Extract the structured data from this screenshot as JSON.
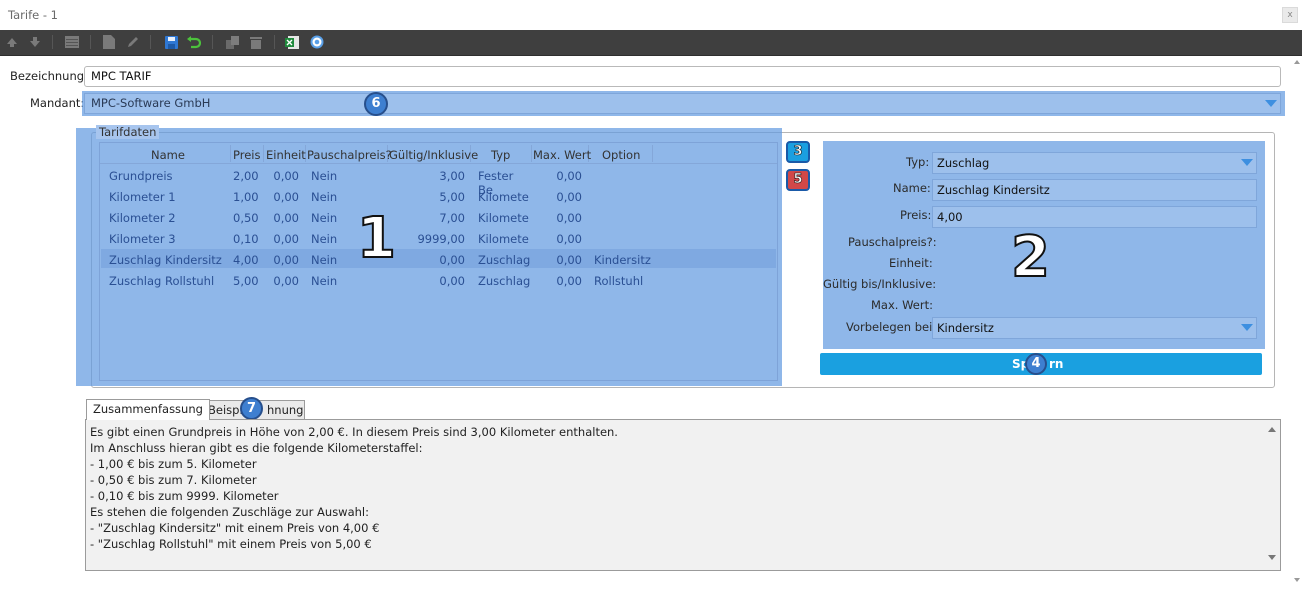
{
  "window": {
    "title": "Tarife - 1",
    "close_glyph": "x"
  },
  "toolbar": {
    "icons": [
      "arrow-up-icon",
      "arrow-down-icon",
      "grid-icon",
      "new-document-icon",
      "edit-pencil-icon",
      "save-disk-icon",
      "undo-arrow-icon",
      "copy-icon",
      "delete-trash-icon",
      "excel-export-icon",
      "help-icon"
    ]
  },
  "form": {
    "bezeichnung_label": "Bezeichnung:",
    "bezeichnung_value": "MPC TARIF",
    "mandant_label": "Mandant:",
    "mandant_value": "MPC-Software GmbH"
  },
  "tarifdaten": {
    "group_label": "Tarifdaten",
    "columns": [
      "Name",
      "Preis",
      "Einheit",
      "Pauschalpreis?",
      "Gültig/Inklusive",
      "Typ",
      "Max. Wert",
      "Option"
    ],
    "rows": [
      {
        "name": "Grundpreis",
        "preis": "2,00",
        "einheit": "0,00",
        "pauschal": "Nein",
        "gueltig": "3,00",
        "typ": "Fester Be",
        "max": "0,00",
        "option": ""
      },
      {
        "name": "Kilometer 1",
        "preis": "1,00",
        "einheit": "0,00",
        "pauschal": "Nein",
        "gueltig": "5,00",
        "typ": "Kilomete",
        "max": "0,00",
        "option": ""
      },
      {
        "name": "Kilometer 2",
        "preis": "0,50",
        "einheit": "0,00",
        "pauschal": "Nein",
        "gueltig": "7,00",
        "typ": "Kilomete",
        "max": "0,00",
        "option": ""
      },
      {
        "name": "Kilometer 3",
        "preis": "0,10",
        "einheit": "0,00",
        "pauschal": "Nein",
        "gueltig": "9999,00",
        "typ": "Kilomete",
        "max": "0,00",
        "option": ""
      },
      {
        "name": "Zuschlag Kindersitz",
        "preis": "4,00",
        "einheit": "0,00",
        "pauschal": "Nein",
        "gueltig": "0,00",
        "typ": "Zuschlag",
        "max": "0,00",
        "option": "Kindersitz"
      },
      {
        "name": "Zuschlag Rollstuhl",
        "preis": "5,00",
        "einheit": "0,00",
        "pauschal": "Nein",
        "gueltig": "0,00",
        "typ": "Zuschlag",
        "max": "0,00",
        "option": "Rollstuhl"
      }
    ],
    "selected_row": 4
  },
  "detail": {
    "typ_label": "Typ:",
    "typ_value": "Zuschlag",
    "name_label": "Name:",
    "name_value": "Zuschlag Kindersitz",
    "preis_label": "Preis:",
    "preis_value": "4,00",
    "pauschal_label": "Pauschalpreis?:",
    "einheit_label": "Einheit:",
    "gueltig_label": "Gültig bis/Inklusive:",
    "max_label": "Max. Wert:",
    "vorbelegen_label": "Vorbelegen bei:",
    "vorbelegen_value": "Kindersitz",
    "save_label_left": "Sp",
    "save_label_right": "rn"
  },
  "tabs": {
    "summary": "Zusammenfassung",
    "example_left": "Beispie",
    "example_right": "hnung"
  },
  "summary_lines": [
    "Es gibt einen Grundpreis in Höhe von 2,00 €. In diesem Preis sind 3,00 Kilometer enthalten.",
    "Im Anschluss hieran gibt es die folgende Kilometerstaffel:",
    "- 1,00 € bis zum 5. Kilometer",
    "- 0,50 € bis zum 7. Kilometer",
    "- 0,10 € bis zum 9999. Kilometer",
    "Es stehen die folgenden Zuschläge zur Auswahl:",
    "- \"Zuschlag Kindersitz\" mit einem Preis von 4,00 €",
    "- \"Zuschlag Rollstuhl\" mit einem Preis von 5,00 €"
  ],
  "annotations": {
    "n1": "1",
    "n2": "2",
    "n3": "3",
    "n4": "4",
    "n5": "5",
    "n6": "6",
    "n7": "7"
  },
  "colors": {
    "overlay": "#649be0",
    "badge": "#3e7fd0",
    "save_button": "#1aa0e0",
    "toolbar": "#3f3f3f",
    "link_text": "#2a4f93"
  }
}
